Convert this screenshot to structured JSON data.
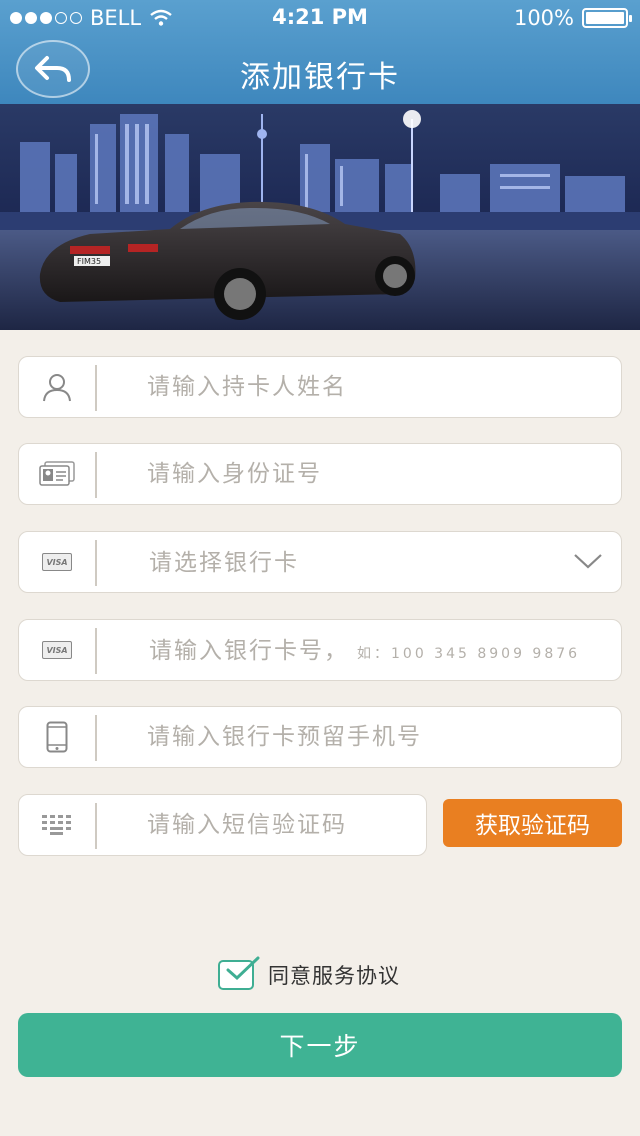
{
  "status_bar": {
    "carrier": "BELL",
    "time": "4:21 PM",
    "battery": "100%",
    "battery_level": 1.0
  },
  "header": {
    "title": "添加银行卡",
    "back_icon": "back-arrow-icon"
  },
  "banner": {
    "badge_text": "FIM35"
  },
  "form": {
    "name": {
      "placeholder": "请输入持卡人姓名",
      "icon": "person-icon"
    },
    "id_number": {
      "placeholder": "请输入身份证号",
      "icon": "id-card-icon"
    },
    "bank": {
      "placeholder": "请选择银行卡",
      "icon": "card-icon",
      "card_text": "VISA"
    },
    "card_number": {
      "placeholder": "请输入银行卡号，",
      "example": "如：100 345 8909 9876",
      "icon": "card-icon",
      "card_text": "VISA"
    },
    "phone": {
      "placeholder": "请输入银行卡预留手机号",
      "icon": "phone-icon"
    },
    "sms_code": {
      "placeholder": "请输入短信验证码",
      "icon": "keypad-icon"
    }
  },
  "get_code_label": "获取验证码",
  "agree_label": "同意服务协议",
  "agree_checked": true,
  "next_label": "下一步",
  "colors": {
    "header": "#4a94c8",
    "accent_orange": "#e97f21",
    "accent_green": "#3fb394",
    "background": "#f3efe9"
  }
}
